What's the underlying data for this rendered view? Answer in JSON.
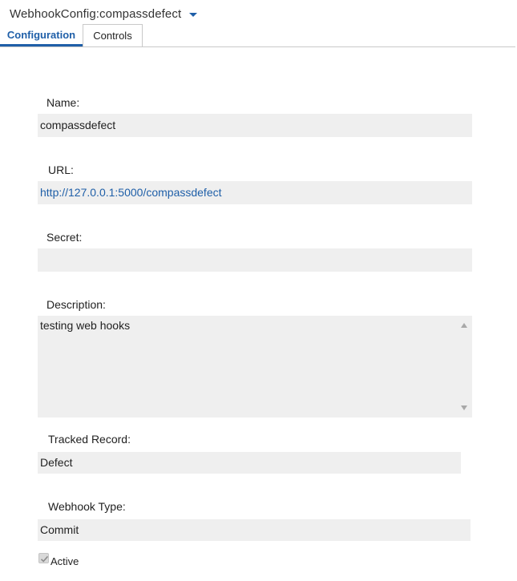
{
  "header": {
    "title": "WebhookConfig:compassdefect"
  },
  "tabs": [
    {
      "label": "Configuration",
      "active": true
    },
    {
      "label": "Controls",
      "active": false
    }
  ],
  "form": {
    "name": {
      "label": "Name:",
      "value": "compassdefect"
    },
    "url": {
      "label": "URL:",
      "value": "http://127.0.0.1:5000/compassdefect"
    },
    "secret": {
      "label": "Secret:",
      "value": ""
    },
    "description": {
      "label": "Description:",
      "value": "testing web hooks"
    },
    "tracked_record": {
      "label": "Tracked Record:",
      "value": "Defect"
    },
    "webhook_type": {
      "label": "Webhook Type:",
      "value": "Commit"
    },
    "active": {
      "label": "Active",
      "checked": true
    }
  },
  "colors": {
    "accent": "#1f5fa8",
    "field_bg": "#efefef",
    "tab_border": "#c9c9c9"
  },
  "icons": {
    "title_menu": "chevron-down-icon",
    "scroll_up": "scroll-up-arrow-icon",
    "scroll_down": "scroll-down-arrow-icon",
    "check": "check-icon"
  }
}
